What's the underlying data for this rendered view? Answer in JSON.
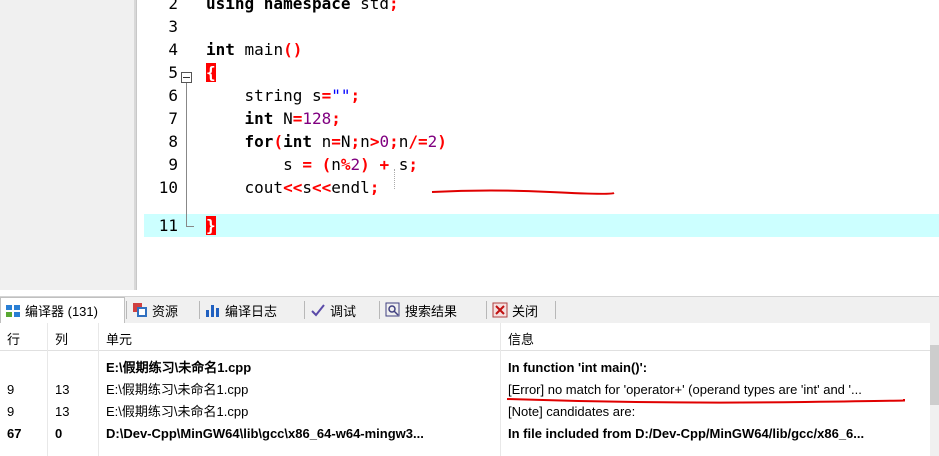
{
  "editor": {
    "lines": [
      {
        "num": "2",
        "code": "using namespace std;"
      },
      {
        "num": "3",
        "code": ""
      },
      {
        "num": "4",
        "code": "int main()"
      },
      {
        "num": "5",
        "code": "{"
      },
      {
        "num": "6",
        "code": "    string s=\"\";"
      },
      {
        "num": "7",
        "code": "    int N=128;"
      },
      {
        "num": "8",
        "code": "    for(int n=N;n>0;n/=2)"
      },
      {
        "num": "9",
        "code": "        s = (n%2) + s;"
      },
      {
        "num": "10",
        "code": "    cout<<s<<endl;"
      },
      {
        "num": "11",
        "code": "}"
      }
    ],
    "highlight_color": "#ccffff",
    "error_mark_color": "#ff0000"
  },
  "tabs": [
    {
      "label": "编译器 (131)",
      "icon": "grid-icon"
    },
    {
      "label": "资源",
      "icon": "resources-icon"
    },
    {
      "label": "编译日志",
      "icon": "chart-icon"
    },
    {
      "label": "调试",
      "icon": "check-icon"
    },
    {
      "label": "搜索结果",
      "icon": "search-icon"
    },
    {
      "label": "关闭",
      "icon": "close-icon"
    }
  ],
  "results": {
    "headers": {
      "line": "行",
      "col": "列",
      "unit": "单元",
      "message": "信息"
    },
    "rows": [
      {
        "line": "",
        "col": "",
        "unit": "E:\\假期练习\\未命名1.cpp",
        "message": "In function 'int main()':",
        "bold": true
      },
      {
        "line": "9",
        "col": "13",
        "unit": "E:\\假期练习\\未命名1.cpp",
        "message": "[Error] no match for 'operator+' (operand types are 'int' and '...",
        "bold": false
      },
      {
        "line": "9",
        "col": "13",
        "unit": "E:\\假期练习\\未命名1.cpp",
        "message": "[Note] candidates are:",
        "bold": false
      },
      {
        "line": "67",
        "col": "0",
        "unit": "D:\\Dev-Cpp\\MinGW64\\lib\\gcc\\x86_64-w64-mingw3...",
        "message": "In file included from D:/Dev-Cpp/MinGW64/lib/gcc/x86_6...",
        "bold": true
      }
    ]
  }
}
